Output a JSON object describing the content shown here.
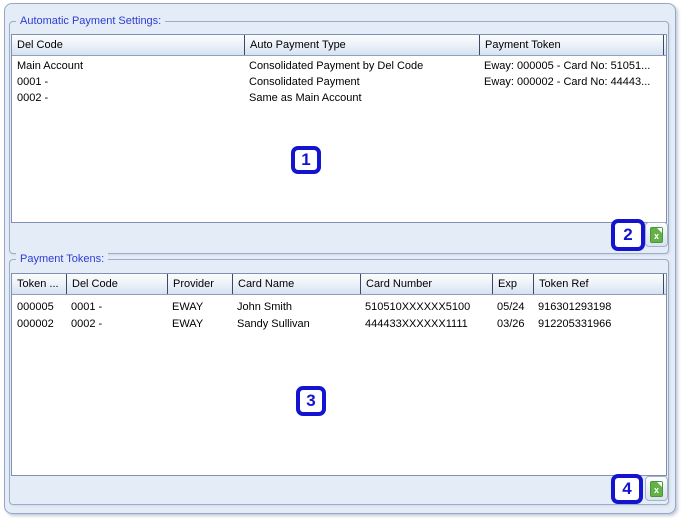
{
  "colors": {
    "panel_background": "#e4ecf7",
    "group_title_blue": "#2e3dd1",
    "annotation_blue": "#1313d0",
    "excel_icon_green": "#64b147",
    "header_gradient_bottom": "#d6e1f1"
  },
  "sections": [
    {
      "title": "Automatic Payment Settings:",
      "columns": [
        "Del Code",
        "Auto Payment Type",
        "Payment Token"
      ],
      "rows": [
        [
          "Main Account",
          "Consolidated Payment by Del Code",
          "Eway: 000005 - Card No: 51051..."
        ],
        [
          "0001 -",
          "Consolidated Payment",
          "Eway: 000002 - Card No: 44443..."
        ],
        [
          "0002 -",
          "Same as Main Account",
          ""
        ]
      ],
      "export_icon": "excel-export-icon",
      "export_icon_letter": "x"
    },
    {
      "title": "Payment Tokens:",
      "columns": [
        "Token ...",
        "Del Code",
        "Provider",
        "Card Name",
        "Card Number",
        "Exp",
        "Token Ref"
      ],
      "rows": [
        [
          "000005",
          "0001 -",
          "EWAY",
          "John Smith",
          "510510XXXXXX5100",
          "05/24",
          "916301293198"
        ],
        [
          "000002",
          "0002 -",
          "EWAY",
          "Sandy Sullivan",
          "444433XXXXXX1111",
          "03/26",
          "912205331966"
        ]
      ],
      "export_icon": "excel-export-icon",
      "export_icon_letter": "x"
    }
  ],
  "annotations": [
    {
      "label": "1"
    },
    {
      "label": "2"
    },
    {
      "label": "3"
    },
    {
      "label": "4"
    }
  ]
}
